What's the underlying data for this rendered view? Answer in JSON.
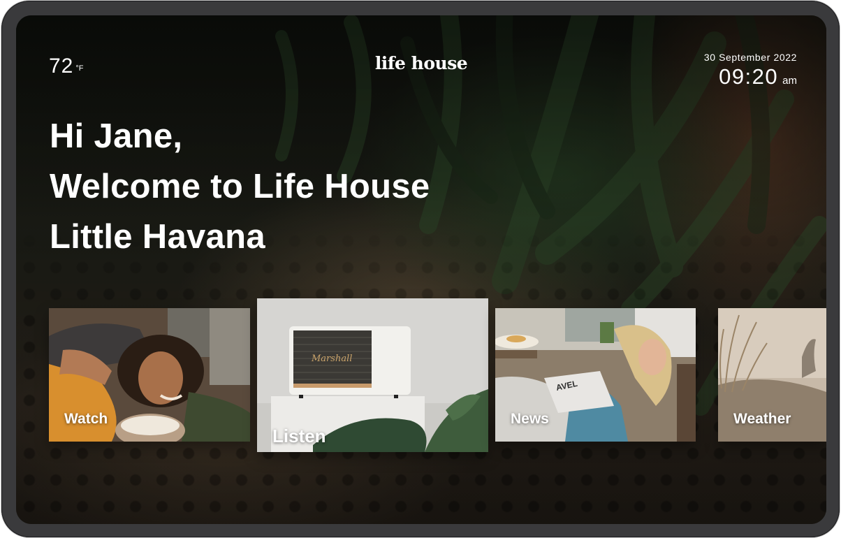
{
  "header": {
    "temperature": "72",
    "temperature_unit": "°F",
    "logo_text": "life house",
    "date": "30 September 2022",
    "time": "09:20",
    "ampm": "am"
  },
  "greeting": {
    "line1": "Hi Jane,",
    "line2": "Welcome to Life House",
    "line3": "Little Havana"
  },
  "tiles": [
    {
      "label": "Watch"
    },
    {
      "label": "Listen",
      "state": "focused"
    },
    {
      "label": "News"
    },
    {
      "label": "Weather"
    }
  ],
  "colors": {
    "text": "#ffffff",
    "device_frame": "#3a3a3c",
    "background_dark": "#141811"
  }
}
